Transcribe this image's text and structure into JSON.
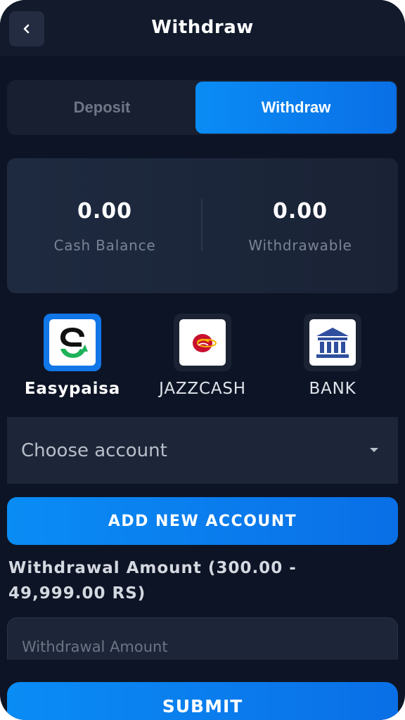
{
  "header": {
    "title": "Withdraw",
    "back_icon": "chevron-left-icon"
  },
  "tabs": [
    {
      "label": "Deposit",
      "active": false
    },
    {
      "label": "Withdraw",
      "active": true
    }
  ],
  "balance": {
    "cash": {
      "value": "0.00",
      "label": "Cash Balance"
    },
    "withdrawable": {
      "value": "0.00",
      "label": "Withdrawable"
    }
  },
  "methods": [
    {
      "label": "Easypaisa",
      "icon": "easypaisa-logo-icon",
      "active": true
    },
    {
      "label": "JAZZCASH",
      "icon": "jazzcash-logo-icon",
      "active": false
    },
    {
      "label": "BANK",
      "icon": "bank-icon",
      "active": false
    }
  ],
  "account_select": {
    "placeholder": "Choose account"
  },
  "add_account_button": "ADD NEW ACCOUNT",
  "amount": {
    "label": "Withdrawal Amount (300.00 - 49,999.00 RS)",
    "placeholder": "Withdrawal Amount"
  },
  "submit_button": "SUBMIT",
  "colors": {
    "background": "#0d1425",
    "accent": "#0a8cf5",
    "card": "#1d2638",
    "jazzcash_logo": "#c8102e",
    "bank_icon": "#2f4f9e",
    "easypaisa_green": "#1fb25a"
  }
}
